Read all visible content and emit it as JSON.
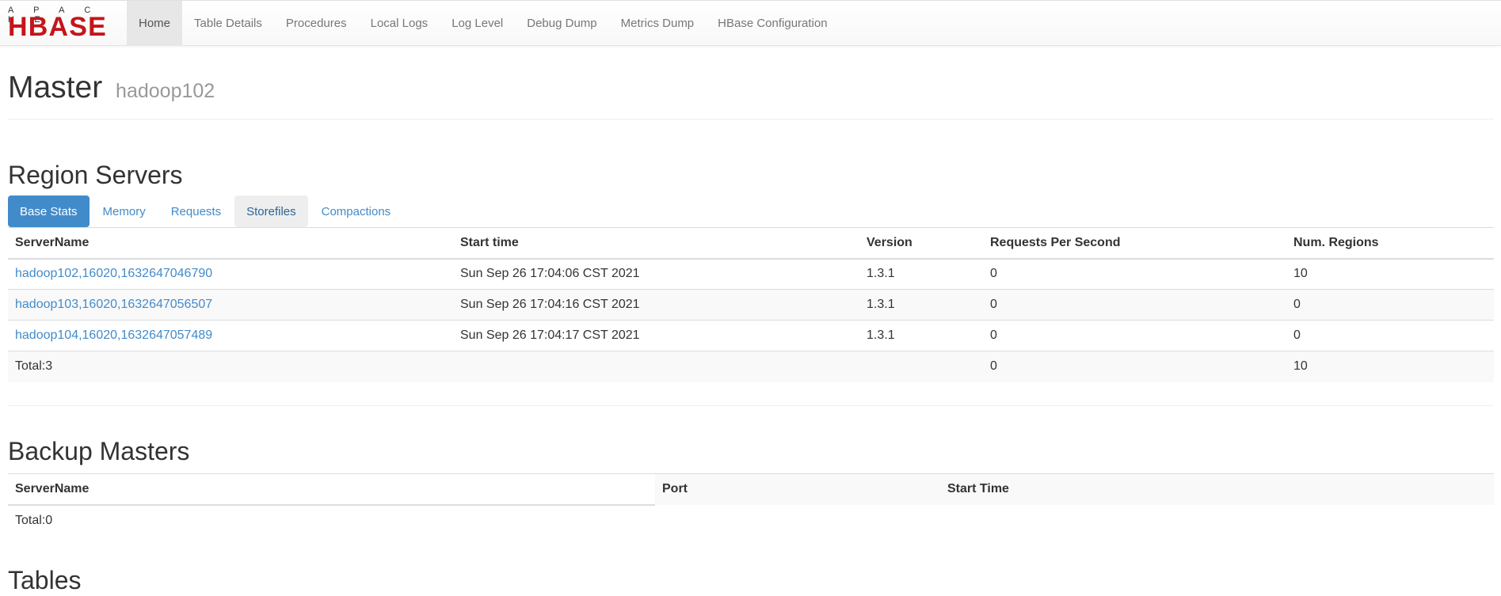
{
  "logo": {
    "top": "A P A C H E",
    "main": "HBASE"
  },
  "nav": {
    "items": [
      "Home",
      "Table Details",
      "Procedures",
      "Local Logs",
      "Log Level",
      "Debug Dump",
      "Metrics Dump",
      "HBase Configuration"
    ]
  },
  "header": {
    "title": "Master",
    "host": "hadoop102"
  },
  "region_servers": {
    "title": "Region Servers",
    "tabs": [
      "Base Stats",
      "Memory",
      "Requests",
      "Storefiles",
      "Compactions"
    ],
    "columns": [
      "ServerName",
      "Start time",
      "Version",
      "Requests Per Second",
      "Num. Regions"
    ],
    "rows": [
      {
        "server": "hadoop102,16020,1632647046790",
        "start": "Sun Sep 26 17:04:06 CST 2021",
        "version": "1.3.1",
        "rps": "0",
        "regions": "10"
      },
      {
        "server": "hadoop103,16020,1632647056507",
        "start": "Sun Sep 26 17:04:16 CST 2021",
        "version": "1.3.1",
        "rps": "0",
        "regions": "0"
      },
      {
        "server": "hadoop104,16020,1632647057489",
        "start": "Sun Sep 26 17:04:17 CST 2021",
        "version": "1.3.1",
        "rps": "0",
        "regions": "0"
      }
    ],
    "total": {
      "label": "Total:3",
      "rps": "0",
      "regions": "10"
    }
  },
  "backup_masters": {
    "title": "Backup Masters",
    "columns": [
      "ServerName",
      "Port",
      "Start Time"
    ],
    "total": "Total:0"
  },
  "tables": {
    "title": "Tables"
  }
}
